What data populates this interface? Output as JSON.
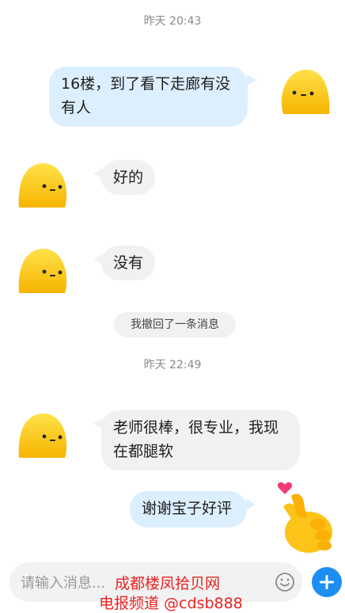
{
  "timestamps": [
    "昨天 20:43",
    "昨天 22:49"
  ],
  "messages": [
    {
      "side": "out",
      "text": "16楼，到了看下走廊有没有人"
    },
    {
      "side": "in",
      "text": "好的"
    },
    {
      "side": "in",
      "text": "没有"
    },
    {
      "side": "system",
      "text": "我撤回了一条消息"
    },
    {
      "side": "in",
      "text": "老师很棒，很专业，我现在都腿软"
    },
    {
      "side": "out",
      "text": "谢谢宝子好评"
    }
  ],
  "input": {
    "placeholder": "请输入消息..."
  },
  "watermark": {
    "line1": "成都楼凤拾贝网",
    "line2": "电报频道 @cdsb888"
  },
  "colors": {
    "outgoing_bubble": "#dcefff",
    "incoming_bubble": "#f1f1f1",
    "accent": "#1c8ff0",
    "watermark": "#e8231f"
  },
  "icons": {
    "avatar": "yellow-blob-avatar-icon",
    "sticker": "finger-heart-icon",
    "emoji": "smiley-icon",
    "add": "plus-icon"
  }
}
